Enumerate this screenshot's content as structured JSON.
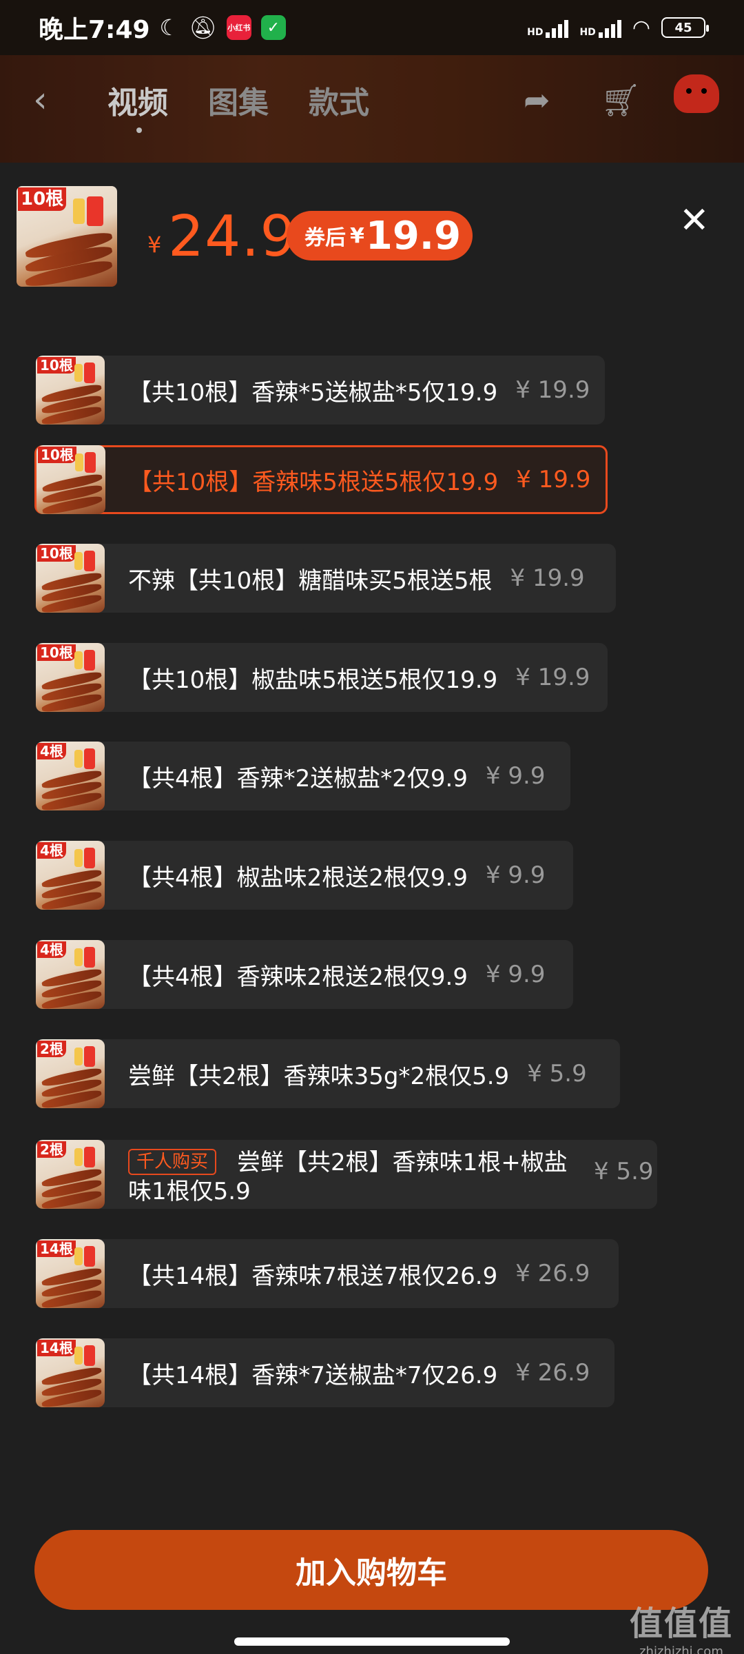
{
  "status_bar": {
    "time": "晚上7:49",
    "app_badge_1": "小红书",
    "app_badge_2": "✓",
    "signal_1": "HD",
    "signal_2": "HD",
    "battery": "45"
  },
  "nav": {
    "tabs": [
      {
        "label": "视频"
      },
      {
        "label": "图集"
      },
      {
        "label": "款式"
      }
    ]
  },
  "sheet": {
    "price_currency": "¥",
    "price": "24.9",
    "coupon_label": "券后",
    "coupon_currency": "¥",
    "coupon_price": "19.9",
    "thumb_tag": "10根"
  },
  "variants": [
    {
      "label": "【共10根】香辣*5送椒盐*5仅19.9",
      "price": "¥ 19.9",
      "tag": "10根"
    },
    {
      "label": "【共10根】香辣味5根送5根仅19.9",
      "price": "¥ 19.9",
      "tag": "10根",
      "selected": true
    },
    {
      "label": "不辣【共10根】糖醋味买5根送5根",
      "price": "¥ 19.9",
      "tag": "10根"
    },
    {
      "label": "【共10根】椒盐味5根送5根仅19.9",
      "price": "¥ 19.9",
      "tag": "10根"
    },
    {
      "label": "【共4根】香辣*2送椒盐*2仅9.9",
      "price": "¥ 9.9",
      "tag": "4根"
    },
    {
      "label": "【共4根】椒盐味2根送2根仅9.9",
      "price": "¥ 9.9",
      "tag": "4根"
    },
    {
      "label": "【共4根】香辣味2根送2根仅9.9",
      "price": "¥ 9.9",
      "tag": "4根"
    },
    {
      "label": "尝鲜【共2根】香辣味35g*2根仅5.9",
      "price": "¥ 5.9",
      "tag": "2根"
    },
    {
      "label": "尝鲜【共2根】香辣味1根+椒盐味1根仅5.9",
      "price": "¥ 5.9",
      "tag": "2根",
      "hot": "千人购买"
    },
    {
      "label": "【共14根】香辣味7根送7根仅26.9",
      "price": "¥ 26.9",
      "tag": "14根"
    },
    {
      "label": "【共14根】香辣*7送椒盐*7仅26.9",
      "price": "¥ 26.9",
      "tag": "14根"
    }
  ],
  "add_to_cart_label": "加入购物车",
  "watermark": {
    "main": "值值值",
    "sub": "zhizhizhi.com"
  },
  "colors": {
    "accent": "#ff5a1f",
    "button": "#c5480f",
    "sheet_bg": "#1f1f1f",
    "item_bg": "#2b2b2b"
  }
}
